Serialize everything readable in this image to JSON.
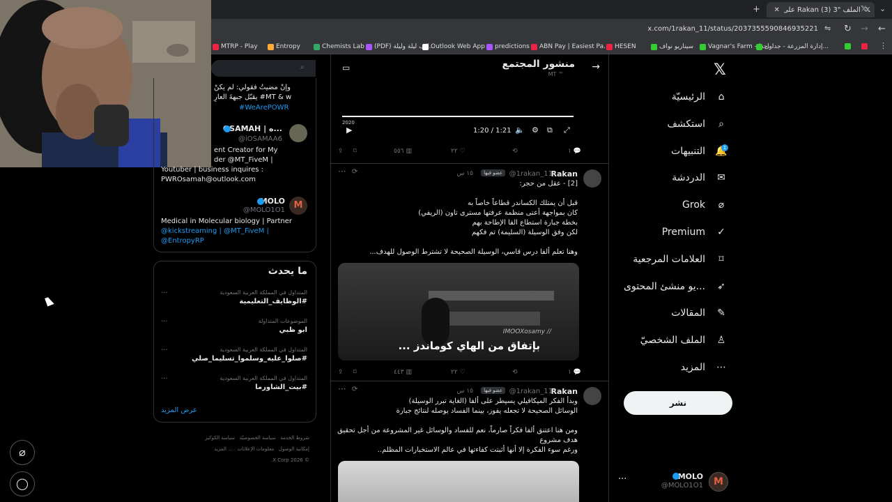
{
  "browser": {
    "tab_title": "الملف \"3 (3) Rakan على X: \"",
    "url": "x.com/1rakan_11/status/2037355590846935221",
    "bookmarks": [
      {
        "label": "MTRP - Play",
        "color": "#e24"
      },
      {
        "label": "Entropy",
        "color": "#fa3"
      },
      {
        "label": "Chemists Lab",
        "color": "#3a6"
      },
      {
        "label": "(PDF) الف ليلة وليلة...",
        "color": "#a5f"
      },
      {
        "label": "Outlook Web App",
        "color": "#fff"
      },
      {
        "label": "predictions",
        "color": "#a5f"
      },
      {
        "label": "ABN Pay | Easiest Pa...",
        "color": "#e24"
      },
      {
        "label": "HESEN",
        "color": "#e24"
      },
      {
        "label": "سيناريو نواف",
        "color": "#3c3"
      },
      {
        "label": "Vagnar's Farm - جدا...",
        "color": "#3c3"
      },
      {
        "label": "إدارة المزرعة - جداول...",
        "color": "#3c3"
      }
    ]
  },
  "nav": {
    "items": [
      {
        "label": "الرئيسيّة",
        "icon": "home-icon"
      },
      {
        "label": "استكشف",
        "icon": "search-icon"
      },
      {
        "label": "التنبيهات",
        "icon": "bell-icon"
      },
      {
        "label": "الدردشة",
        "icon": "mail-icon"
      },
      {
        "label": "Grok",
        "icon": "grok-icon"
      },
      {
        "label": "Premium",
        "icon": "premium-icon"
      },
      {
        "label": "العلامات المرجعية",
        "icon": "bookmark-icon"
      },
      {
        "label": "...يو منشئ المحتوى",
        "icon": "rocket-icon"
      },
      {
        "label": "المقالات",
        "icon": "article-icon"
      },
      {
        "label": "الملف الشخصيّ",
        "icon": "person-icon"
      },
      {
        "label": "المزيد",
        "icon": "more-icon"
      }
    ],
    "notification_count": "1",
    "post_label": "نشر",
    "account_name": "MOLO",
    "account_handle": "@MOLO1O1"
  },
  "header": {
    "title": "منشور المجتمع",
    "subtitle": "MT ™"
  },
  "video": {
    "year": "2020",
    "time": "1:20 / 1:21"
  },
  "tweet1_actions": {
    "reply": "١",
    "retweet": "",
    "like": "٢٢",
    "views": "٥٥٦"
  },
  "tweet2": {
    "name": "Rakan",
    "handle": "@1rakan_11",
    "badge": "عضو فيها",
    "time": "١٥ س",
    "line0": "[2] - عقل من حجر:",
    "lines": [
      "قبل أن يمتلك الكساندر قطاعاً خاصاً به",
      "كان بمواجهة أعتى منظمة عرفتها مسترى تاون (الريفي)",
      "بخطة جبارة استطاع الفا الإطاحة بهم",
      "لكن وفق الوسيلة (السليمة) تم فكهم",
      "وهنا تعلم ألفا درس قاسي، الوسيلة الصحيحة لا تشترط الوصول للهدف..."
    ],
    "caption": "بإتفاق من الهاي كوماندز ...",
    "watermark": "IMOOXosamy //",
    "actions": {
      "reply": "١",
      "like": "٢٢",
      "views": "٤٤٣"
    }
  },
  "tweet3": {
    "name": "Rakan",
    "handle": "@1rakan_11",
    "badge": "عضو فيها",
    "time": "١٥ س",
    "lines": [
      "وبدأ الفكر الميكافيلي يسيطر على ألفا (الغاية تبرر الوسيلة)",
      "الوسائل الصحيحة لا تجعله يفوز، بينما الفساد يوصله لنتائج جبارة",
      "ومن هنا اعتنق ألفا فكراً صارماً، نعم للفساد والوسائل غير المشروعة من أجل تحقيق",
      "هدف مشروع",
      "ورغم سوء الفكرة إلا أنها أثبتت كفاءتها في عالم الاستخبارات المظلم.."
    ]
  },
  "sidebar": {
    "search_text": "",
    "bio_lines": [
      "وإنْ مضيتُ فقولي: لم يكنْ",
      "يقبّل جبهةَ العارِ #MT & w",
      "#WeArePOWR"
    ],
    "users": [
      {
        "name": "OSAMAH | ه...",
        "handle": "@iOSAMAA6",
        "bio1": "ent Creator for My",
        "bio2": "der @MT_FiveM |",
        "bio3": "Youtuber | business inquires :",
        "bio4": "PWROsamah@outlook.com"
      },
      {
        "name": "MOLO",
        "handle": "@MOLO1O1",
        "bio1": "Medical in Molecular biology | Partner",
        "bio2": "@kickstreaming | @MT_FiveM |",
        "bio3": "@EntropyRP"
      }
    ],
    "trends_title": "ما يحدث",
    "trends": [
      {
        "context": "المتداول في المملكة العربية السعودية",
        "name": "#الوظايف_التعليمية"
      },
      {
        "context": "الموضوعات المتداولة",
        "name": "ابو ظبي"
      },
      {
        "context": "المتداول في المملكة العربية السعودية",
        "name": "#صلوا_عليه_وسلموا_تسليما_صلي"
      },
      {
        "context": "المتداول في المملكة العربية السعودية",
        "name": "#بيت_الشاورما"
      }
    ],
    "show_more": "عرض المزيد",
    "footer": [
      "شروط الخدمة",
      "سياسة الخصوصيّة",
      "سياسة الكوكيز",
      "إمكانية الوصول",
      "معلومات الإعلانات",
      "... المزيد",
      "© 2026 X Corp."
    ]
  }
}
